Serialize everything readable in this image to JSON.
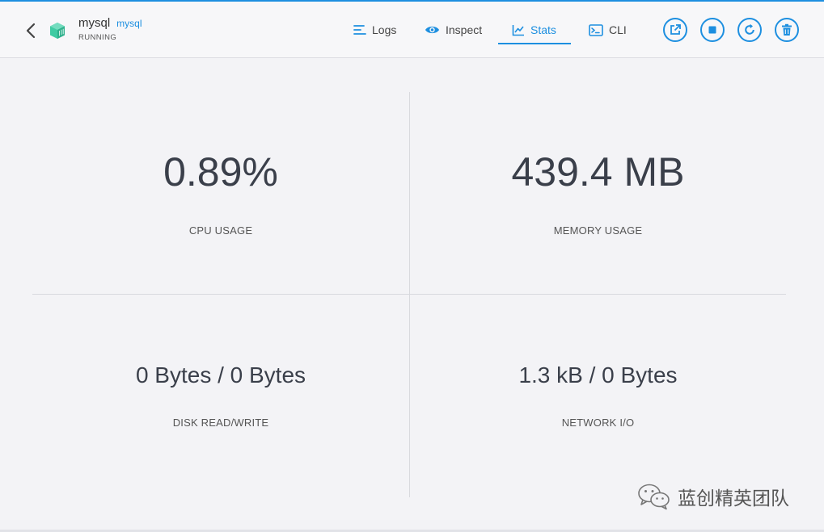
{
  "container": {
    "name": "mysql",
    "image": "mysql",
    "status": "RUNNING"
  },
  "tabs": [
    {
      "label": "Logs",
      "icon": "logs-icon",
      "active": false
    },
    {
      "label": "Inspect",
      "icon": "eye-icon",
      "active": false
    },
    {
      "label": "Stats",
      "icon": "chart-icon",
      "active": true
    },
    {
      "label": "CLI",
      "icon": "terminal-icon",
      "active": false
    }
  ],
  "actions": [
    {
      "name": "open-browser-button",
      "icon": "external-link-icon"
    },
    {
      "name": "stop-button",
      "icon": "stop-icon"
    },
    {
      "name": "restart-button",
      "icon": "restart-icon"
    },
    {
      "name": "delete-button",
      "icon": "trash-icon"
    }
  ],
  "stats": {
    "cpu": {
      "value": "0.89%",
      "label": "CPU USAGE"
    },
    "memory": {
      "value": "439.4 MB",
      "label": "MEMORY USAGE"
    },
    "disk": {
      "value": "0 Bytes / 0 Bytes",
      "label": "DISK READ/WRITE"
    },
    "network": {
      "value": "1.3 kB / 0 Bytes",
      "label": "NETWORK I/O"
    }
  },
  "watermark": {
    "text": "蓝创精英团队",
    "icon": "wechat-icon"
  },
  "colors": {
    "accent": "#1d8fe0",
    "container_icon": "#3fcba3",
    "background": "#f3f3f6"
  }
}
